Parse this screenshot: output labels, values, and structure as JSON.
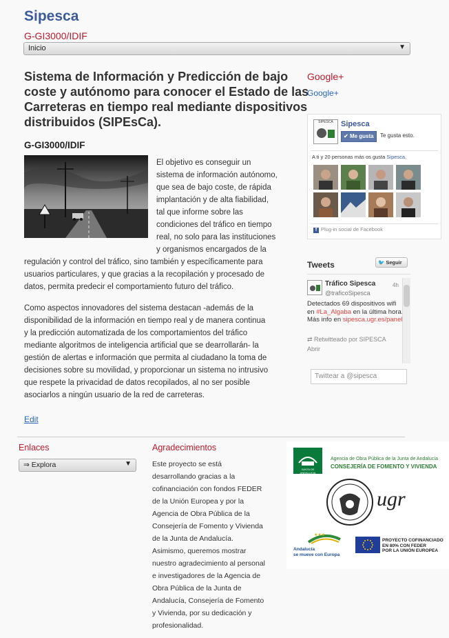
{
  "header": {
    "site_title": "Sipesca",
    "site_subtitle": "G-GI3000/IDIF",
    "nav_selected": "Inicio"
  },
  "article": {
    "title_lines": [
      "Sistema de Información y Predicción de bajo",
      "coste y autónomo para conocer el Estado de las",
      "Carreteras en tiempo real mediante dispositivos",
      "distribuidos (SIPEsCa)."
    ],
    "subtitle": "G-GI3000/IDIF",
    "paragraph1_lines": [
      "El objetivo es conseguir un",
      "sistema de información autónomo,",
      "que sea de bajo coste, de rápida",
      "implantación y de alta fiabilidad,",
      "tal que informe sobre las",
      "condiciones del tráfico en tiempo",
      "real, no solo para las instituciones",
      "y organismos encargados de la",
      "regulación y control del tráfico, sino también y específicamente para",
      "usuarios particulares, y que gracias a la recopilación y procesado de",
      "datos, permita predecir el comportamiento futuro del tráfico."
    ],
    "paragraph2_lines": [
      "Como aspectos innovadores del sistema destacan -además de la",
      "disponibilidad de la información en tiempo real y de manera continua",
      "y la predicción automatizada de los comportamientos del tráfico",
      "mediante algoritmos de inteligencia artificial que se dearrollarán- la",
      "gestión de alertas e información que permita al ciudadano la toma de",
      "decisiones sobre su movilidad, y proporcionar un sistema no intrusivo",
      "que respete la privacidad de datos recopilados, al no ser posible",
      "asociarlos a ningún usuario de la red de carreteras."
    ],
    "edit_label": "Edit"
  },
  "sidebar": {
    "gplus_title": "Google+",
    "gplus_link": "Google+",
    "facebook": {
      "logo_text": "SIPESCA",
      "page_name": "Sipesca",
      "like_button": "Me gusta",
      "like_text": "Te gusta esto.",
      "count_prefix": "A ti y 20 personas más os gusta ",
      "count_page": "Sipesca",
      "count_suffix": ".",
      "plugin_label": "Plug-in social de Facebook",
      "icon": "facebook-icon"
    },
    "twitter": {
      "title": "Tweets",
      "follow_label": "Seguir",
      "follow_icon": "twitter-bird-icon",
      "tweet_name": "Tráfico Sipesca",
      "tweet_handle": "@traficoSipesca",
      "tweet_time": "4h",
      "tweet_text_1": "Detectados 69 dispositivos wifi en ",
      "tweet_hashtag": "#La_Algaba",
      "tweet_text_2": " en la última hora. Más info en ",
      "tweet_link": "sipesca.ugr.es/panel",
      "retweet_label": "Retwitteado por SIPESCA",
      "open_label": "Abrir",
      "input_placeholder": "Twittear a @sipesca"
    }
  },
  "footer": {
    "links_title": "Enlaces",
    "links_selected": "⇒ Explora",
    "thanks_title": "Agradecimientos",
    "thanks_lines": [
      "Este proyecto se está",
      "desarrollando gracias a la",
      "cofinanciación con fondos FEDER",
      "de la Unión Europea y por la",
      "Agencia de Obra Pública de la",
      "Consejería de Fomento y Vivienda",
      "de la Junta de Andalucía.",
      "Asimismo, queremos mostrar",
      "nuestro agradecimiento al personal",
      "e investigadores de la Agencia de",
      "Obra Pública de la Junta de",
      "Andalucía, Consejería de Fomento",
      "y Vivienda, por su dedicación y",
      "profesionalidad."
    ],
    "logos": {
      "junta_small": "JUNTA DE ANDALUCIA",
      "junta_line1": "Agencia de Obra Pública de la Junta de Andalucía",
      "junta_line2": "CONSEJERÍA DE FOMENTO Y VIVIENDA",
      "ugr_text": "ugr",
      "andalucia_line1": "Andalucía",
      "andalucia_line2": "se mueve con Europa",
      "eu_line1": "PROYECTO COFINANCIADO",
      "eu_line2": "EN 80% CON FEDER",
      "eu_line3": "POR LA UNIÓN EUROPEA"
    }
  }
}
